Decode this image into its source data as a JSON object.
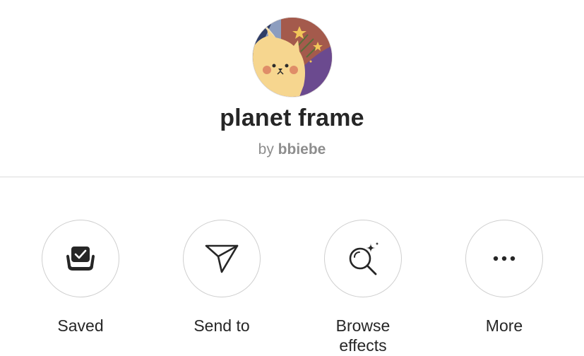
{
  "effect": {
    "name": "planet frame",
    "by_prefix": "by",
    "author": "bbiebe",
    "avatar_icon": "bear-planet-avatar"
  },
  "actions": [
    {
      "label": "Saved",
      "icon": "saved-bookmark-icon"
    },
    {
      "label": "Send to",
      "icon": "paper-plane-icon"
    },
    {
      "label": "Browse effects",
      "icon": "search-sparkle-icon"
    },
    {
      "label": "More",
      "icon": "ellipsis-icon"
    }
  ],
  "colors": {
    "text": "#262626",
    "muted": "#8e8e8e",
    "divider": "#dbdbdb",
    "circle_border": "#cfcfcf"
  }
}
